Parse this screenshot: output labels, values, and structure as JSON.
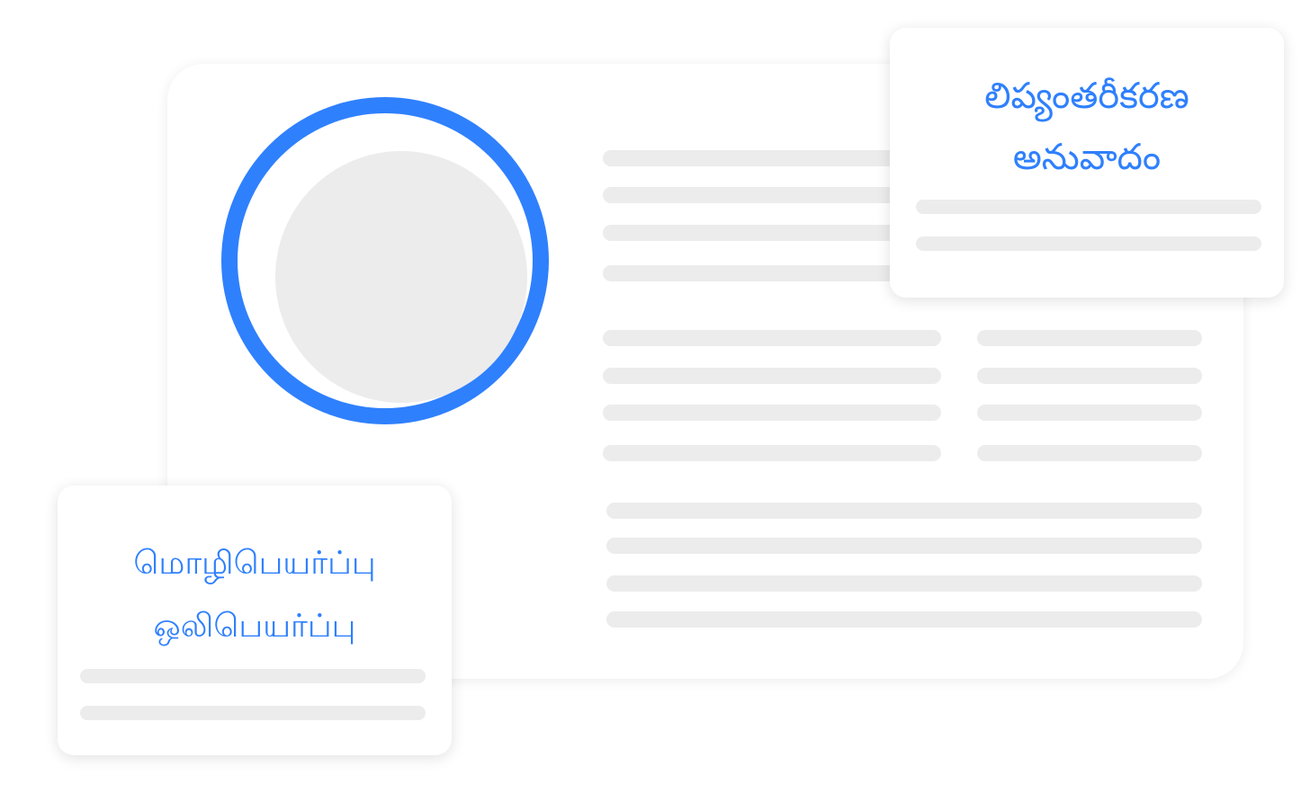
{
  "colors": {
    "accent": "#2f80fd",
    "placeholder": "#ececec",
    "background": "#ffffff"
  },
  "telugu_card": {
    "line1": "లిప్యంతరీకరణ",
    "line2": "అనువాదం"
  },
  "tamil_card": {
    "line1": "மொழிபெயர்ப்பு",
    "line2": "ஒலிபெயர்ப்பு"
  }
}
